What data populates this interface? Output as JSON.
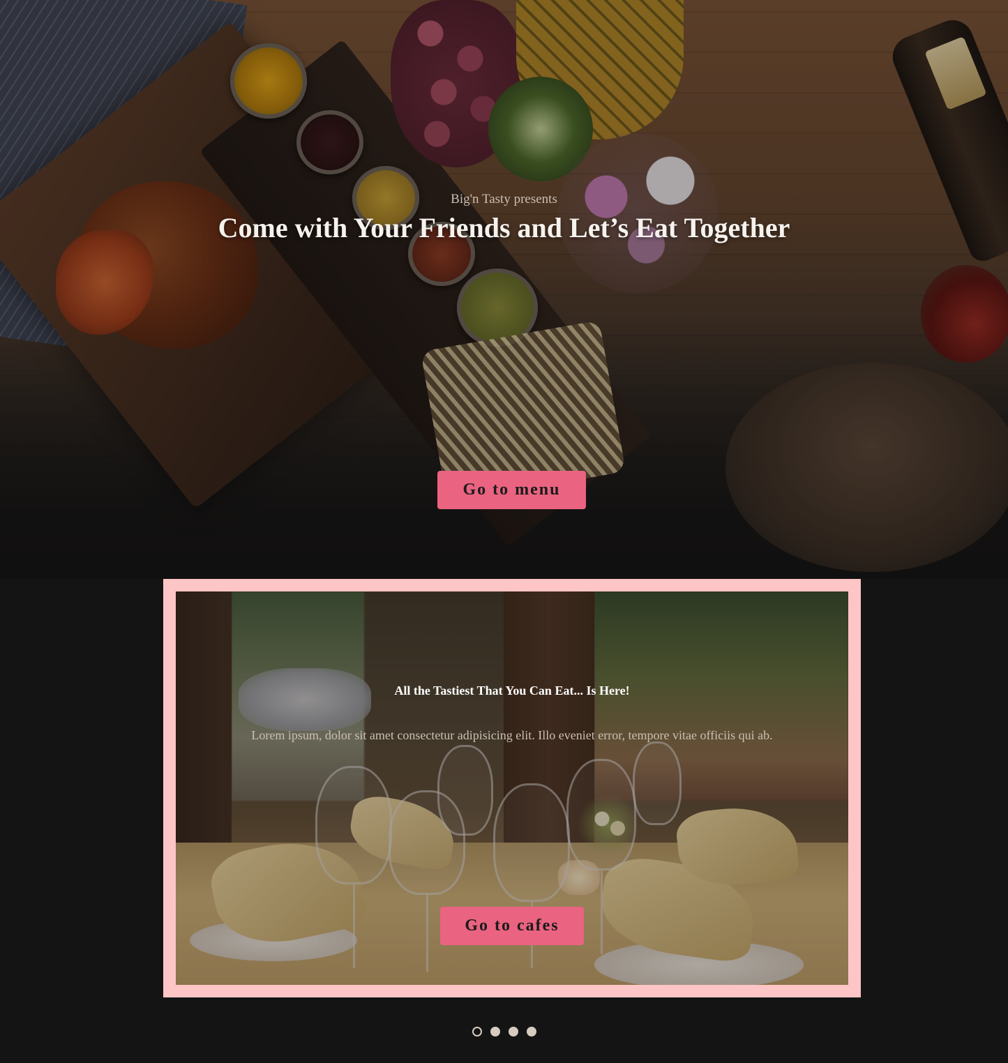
{
  "hero": {
    "subtitle": "Big'n Tasty presents",
    "title": "Come with Your Friends and Let’s Eat Together",
    "button_label": "Go to menu"
  },
  "carousel": {
    "slides": [
      {
        "title": "All the Tastiest That You Can Eat... Is Here!",
        "text": "Lorem ipsum, dolor sit amet consectetur adipisicing elit. Illo eveniet error, tempore vitae officiis qui ab.",
        "button_label": "Go to cafes"
      }
    ],
    "active_index": 0,
    "dot_count": 4
  },
  "colors": {
    "accent": "#ea6380",
    "frame": "#fec5c6",
    "background": "#141414"
  }
}
